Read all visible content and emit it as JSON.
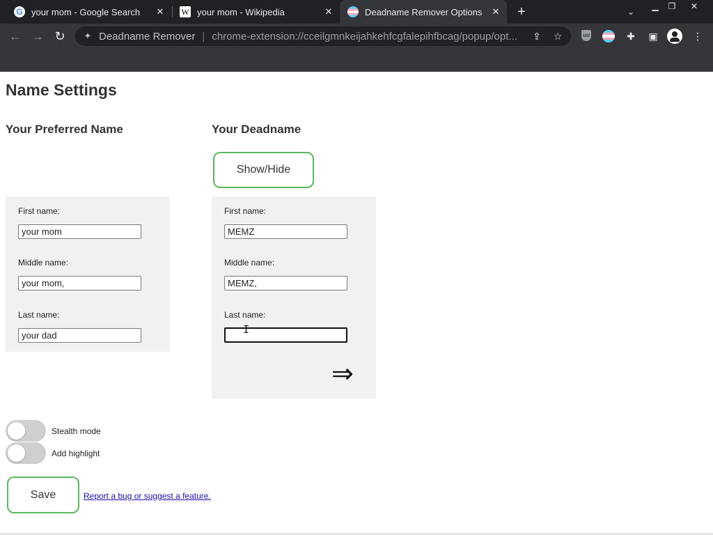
{
  "tabs": [
    {
      "title": "your mom - Google Search",
      "favicon": "google-icon",
      "active": false
    },
    {
      "title": "your mom - Wikipedia",
      "favicon": "wikipedia-icon",
      "active": false
    },
    {
      "title": "Deadname Remover Options",
      "favicon": "trans-flag-icon",
      "active": true
    }
  ],
  "omnibox": {
    "site_name": "Deadname Remover",
    "url": "chrome-extension://cceilgmnkeijahkehfcgfalepihfbcag/popup/opt..."
  },
  "page": {
    "title": "Name Settings",
    "preferred": {
      "heading": "Your Preferred Name",
      "first_label": "First name:",
      "first_value": "your mom",
      "middle_label": "Middle name:",
      "middle_value": "your mom,",
      "last_label": "Last name:",
      "last_value": "your dad"
    },
    "deadname": {
      "heading": "Your Deadname",
      "show_hide_label": "Show/Hide",
      "first_label": "First name:",
      "first_value": "MEMZ",
      "middle_label": "Middle name:",
      "middle_value": "MEMZ,",
      "last_label": "Last name:",
      "last_value": "",
      "arrow": "⇒"
    },
    "toggles": [
      {
        "label": "Stealth mode",
        "on": false
      },
      {
        "label": "Add highlight",
        "on": false
      }
    ],
    "save_label": "Save",
    "report_link": "Report a bug or suggest a feature."
  },
  "colors": {
    "accent_green": "#5cb85c",
    "panel_bg": "#f1f1f1",
    "chrome_dark": "#202124",
    "chrome_toolbar": "#35363a"
  }
}
